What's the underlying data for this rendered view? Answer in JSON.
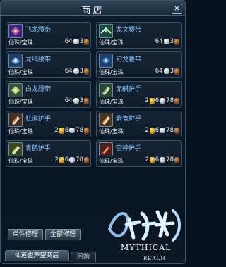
{
  "window": {
    "title": "商店",
    "close_icon": "close-icon"
  },
  "items": [
    {
      "name": "飞龙腰带",
      "currency": "仙珠/宝珠",
      "silver": "64",
      "copper": "3",
      "icon": "purple-belt-icon"
    },
    {
      "name": "龙文腰带",
      "currency": "仙珠/宝珠",
      "silver": "64",
      "copper": "3",
      "icon": "green-belt-icon"
    },
    {
      "name": "龙绡腰带",
      "currency": "仙珠/宝珠",
      "silver": "64",
      "copper": "3",
      "icon": "blue-belt-icon"
    },
    {
      "name": "幻龙腰带",
      "currency": "仙珠/宝珠",
      "silver": "64",
      "copper": "3",
      "icon": "blue-belt-icon"
    },
    {
      "name": "白龙腰带",
      "currency": "仙珠/宝珠",
      "silver": "64",
      "copper": "3",
      "icon": "jade-belt-icon"
    },
    {
      "name": "赤麒护手",
      "currency": "仙珠/宝珠",
      "gold": "2",
      "silver": "6",
      "copper": "78",
      "icon": "green-gauntlet-icon"
    },
    {
      "name": "狂湃护手",
      "currency": "仙珠/宝珠",
      "gold": "2",
      "silver": "6",
      "copper": "78",
      "icon": "orange-gauntlet-icon"
    },
    {
      "name": "紫寰护手",
      "currency": "仙珠/宝珠",
      "gold": "2",
      "silver": "6",
      "copper": "78",
      "icon": "orange-gauntlet-icon"
    },
    {
      "name": "青鹤护手",
      "currency": "仙珠/宝珠",
      "gold": "2",
      "silver": "6",
      "copper": "78",
      "icon": "green-gauntlet-icon"
    },
    {
      "name": "空神护手",
      "currency": "仙珠/宝珠",
      "gold": "2",
      "silver": "6",
      "copper": "78",
      "icon": "red-gauntlet-icon"
    }
  ],
  "buttons": {
    "repair_one": "单件修理",
    "repair_all": "全部修理"
  },
  "tabs": {
    "league_shop": "仙道盟声望商店",
    "buyback": "回购"
  },
  "logo": {
    "cn": "仙侠世界",
    "en_line1": "MYTHICAL",
    "en_line2": "REALM"
  },
  "colors": {
    "item_name": "#8fc8ff",
    "panel_bg": "#0a1522",
    "border": "#3b4e62"
  }
}
